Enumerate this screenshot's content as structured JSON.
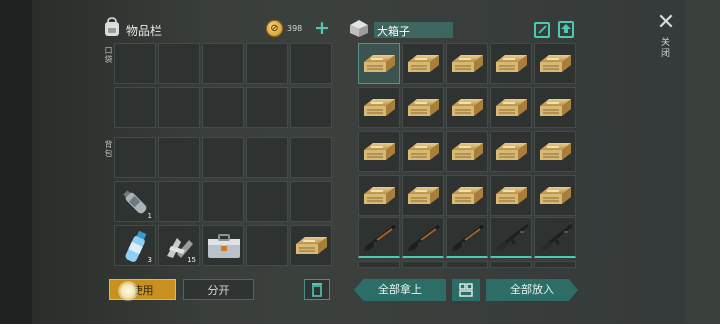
{
  "inventory": {
    "title": "物品栏",
    "coins": "398",
    "pocket_label": "口袋",
    "bag_label": "背包",
    "items": {
      "bottle_qty": "1",
      "water_qty": "3",
      "parts_qty": "15"
    }
  },
  "chest": {
    "name": "大箱子"
  },
  "buttons": {
    "use": "使用",
    "split": "分开",
    "take_all": "全部拿上",
    "put_all": "全部放入"
  },
  "close_label": "关闭",
  "icons": {
    "backpack": "backpack-icon",
    "coin": "coin-icon",
    "add": "plus-icon",
    "chest": "chest-icon",
    "edit": "edit-icon",
    "upload": "upload-icon",
    "close": "close-icon",
    "trash": "trash-icon",
    "sort": "sort-grid-icon",
    "crate": "crate-icon",
    "shotgun": "shotgun-icon",
    "rifle": "rifle-icon"
  },
  "colors": {
    "accent": "#4ec7b3",
    "use_button": "#c8911f",
    "teal_button": "#2c6e67"
  }
}
